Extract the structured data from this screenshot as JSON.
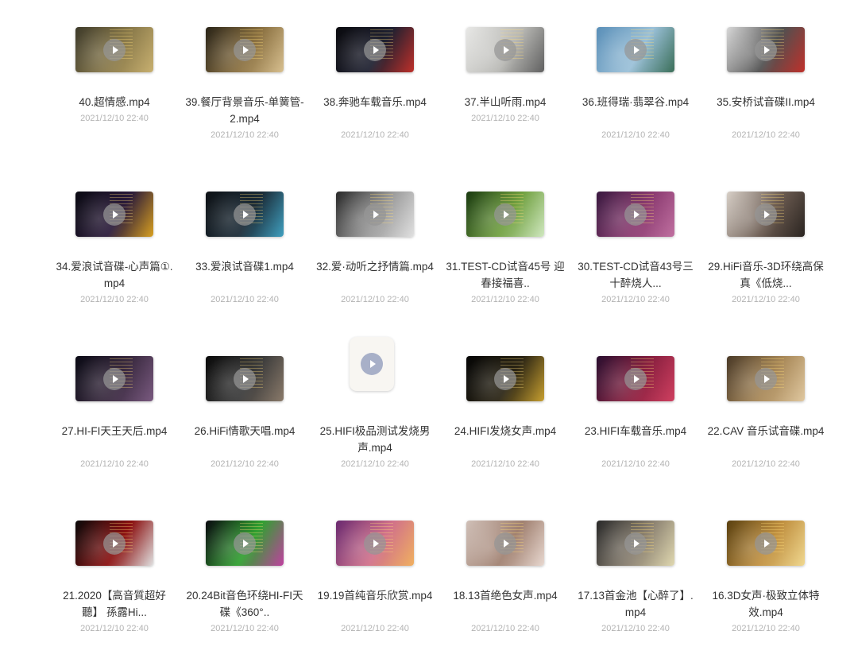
{
  "files": [
    {
      "name": "40.超情感.mp4",
      "date": "2021/12/10 22:40",
      "lines": 1,
      "thumb": "woman-headphones",
      "colors": [
        "#3d3a2a",
        "#8a7a4a",
        "#c8b070"
      ]
    },
    {
      "name": "39.餐厅背景音乐-单簧管-2.mp4",
      "date": "2021/12/10 22:40",
      "lines": 2,
      "thumb": "clarinet",
      "colors": [
        "#2a2418",
        "#8a7040",
        "#d8c090"
      ]
    },
    {
      "name": "38.奔驰车载音乐.mp4",
      "date": "2021/12/10 22:40",
      "lines": 2,
      "thumb": "car-interior",
      "colors": [
        "#0a0a0e",
        "#1e2030",
        "#c0302a"
      ]
    },
    {
      "name": "37.半山听雨.mp4",
      "date": "2021/12/10 22:40",
      "lines": 1,
      "thumb": "ink-landscape",
      "colors": [
        "#e8e8e6",
        "#b8b8b4",
        "#606060"
      ]
    },
    {
      "name": "36.班得瑞·翡翠谷.mp4",
      "date": "2021/12/10 22:40",
      "lines": 2,
      "thumb": "lake",
      "colors": [
        "#5a8fb8",
        "#9ac0d8",
        "#3a6e58"
      ]
    },
    {
      "name": "35.安桥试音碟II.mp4",
      "date": "2021/12/10 22:40",
      "lines": 2,
      "thumb": "guitar-amp",
      "colors": [
        "#d8d8d8",
        "#505050",
        "#c0302a"
      ]
    },
    {
      "name": "34.爱浪试音碟-心声篇①.mp4",
      "date": "2021/12/10 22:40",
      "lines": 2,
      "thumb": "guitar",
      "colors": [
        "#0a0a12",
        "#2a1a3a",
        "#d8a020"
      ]
    },
    {
      "name": "33.爱浪试音碟1.mp4",
      "date": "2021/12/10 22:40",
      "lines": 2,
      "thumb": "vinyl",
      "colors": [
        "#0e1216",
        "#1a2a36",
        "#40a0c0"
      ]
    },
    {
      "name": "32.爱·动听之抒情篇.mp4",
      "date": "2021/12/10 22:40",
      "lines": 2,
      "thumb": "bw-portrait",
      "colors": [
        "#2a2a2a",
        "#9a9a9a",
        "#e0e0e0"
      ]
    },
    {
      "name": "31.TEST-CD试音45号 迎春接福喜..",
      "date": "2021/12/10 22:40",
      "lines": 2,
      "thumb": "spring-green",
      "colors": [
        "#1a3a10",
        "#70a040",
        "#d0e8c0"
      ]
    },
    {
      "name": "30.TEST-CD试音43号三十醉烧人...",
      "date": "2021/12/10 22:40",
      "lines": 2,
      "thumb": "microphone",
      "colors": [
        "#3a1a40",
        "#8a3a70",
        "#c070a0"
      ]
    },
    {
      "name": "29.HiFi音乐-3D环绕高保真《低烧...",
      "date": "2021/12/10 22:40",
      "lines": 2,
      "thumb": "woman-window",
      "colors": [
        "#d8d0c8",
        "#6a5a50",
        "#2a2420"
      ]
    },
    {
      "name": "27.HI-FI天王天后.mp4",
      "date": "2021/12/10 22:40",
      "lines": 2,
      "thumb": "car-driver",
      "colors": [
        "#0a0a14",
        "#3a2a40",
        "#7a5a80"
      ]
    },
    {
      "name": "26.HiFi情歌天唱.mp4",
      "date": "2021/12/10 22:40",
      "lines": 2,
      "thumb": "speaker",
      "colors": [
        "#0a0a0a",
        "#3a3a3a",
        "#8a7a6a"
      ]
    },
    {
      "name": "25.HIFI极品测试发烧男声.mp4",
      "date": "2021/12/10 22:40",
      "lines": 2,
      "thumb": "generic",
      "colors": [
        "#f8f6f2",
        "#f8f6f2",
        "#f8f6f2"
      ]
    },
    {
      "name": "24.HIFI发烧女声.mp4",
      "date": "2021/12/10 22:40",
      "lines": 2,
      "thumb": "speaker-gold",
      "colors": [
        "#050505",
        "#2a2414",
        "#c8a030"
      ]
    },
    {
      "name": "23.HIFI车载音乐.mp4",
      "date": "2021/12/10 22:40",
      "lines": 2,
      "thumb": "earbuds",
      "colors": [
        "#2a1030",
        "#8a2040",
        "#d04060"
      ]
    },
    {
      "name": "22.CAV 音乐试音碟.mp4",
      "date": "2021/12/10 22:40",
      "lines": 2,
      "thumb": "turntable",
      "colors": [
        "#4a3a28",
        "#a88858",
        "#e0c8a0"
      ]
    },
    {
      "name": "21.2020【高音質超好聽】 孫露Hi...",
      "date": "2021/12/10 22:40",
      "lines": 2,
      "thumb": "woman-red",
      "colors": [
        "#0a0a0a",
        "#8a1010",
        "#e0e0e0"
      ]
    },
    {
      "name": "20.24Bit音色环绕HI-FI天碟《360°..",
      "date": "2021/12/10 22:40",
      "lines": 2,
      "thumb": "mic-colorful",
      "colors": [
        "#0a0a10",
        "#30a030",
        "#c040a0"
      ]
    },
    {
      "name": "19.19首纯音乐欣赏.mp4",
      "date": "2021/12/10 22:40",
      "lines": 2,
      "thumb": "sunset-violin",
      "colors": [
        "#6a2a70",
        "#d0708a",
        "#f0b060"
      ]
    },
    {
      "name": "18.13首绝色女声.mp4",
      "date": "2021/12/10 22:40",
      "lines": 2,
      "thumb": "wall-woman",
      "colors": [
        "#d0c0b8",
        "#a08070",
        "#e8d8d0"
      ]
    },
    {
      "name": "17.13首金池【心醉了】.mp4",
      "date": "2021/12/10 22:40",
      "lines": 2,
      "thumb": "dusk-field",
      "colors": [
        "#2a2a2a",
        "#8a8070",
        "#e0d8b0"
      ]
    },
    {
      "name": "16.3D女声·极致立体特效.mp4",
      "date": "2021/12/10 22:40",
      "lines": 2,
      "thumb": "golden-field",
      "colors": [
        "#5a4010",
        "#c09040",
        "#f0d890"
      ]
    }
  ]
}
